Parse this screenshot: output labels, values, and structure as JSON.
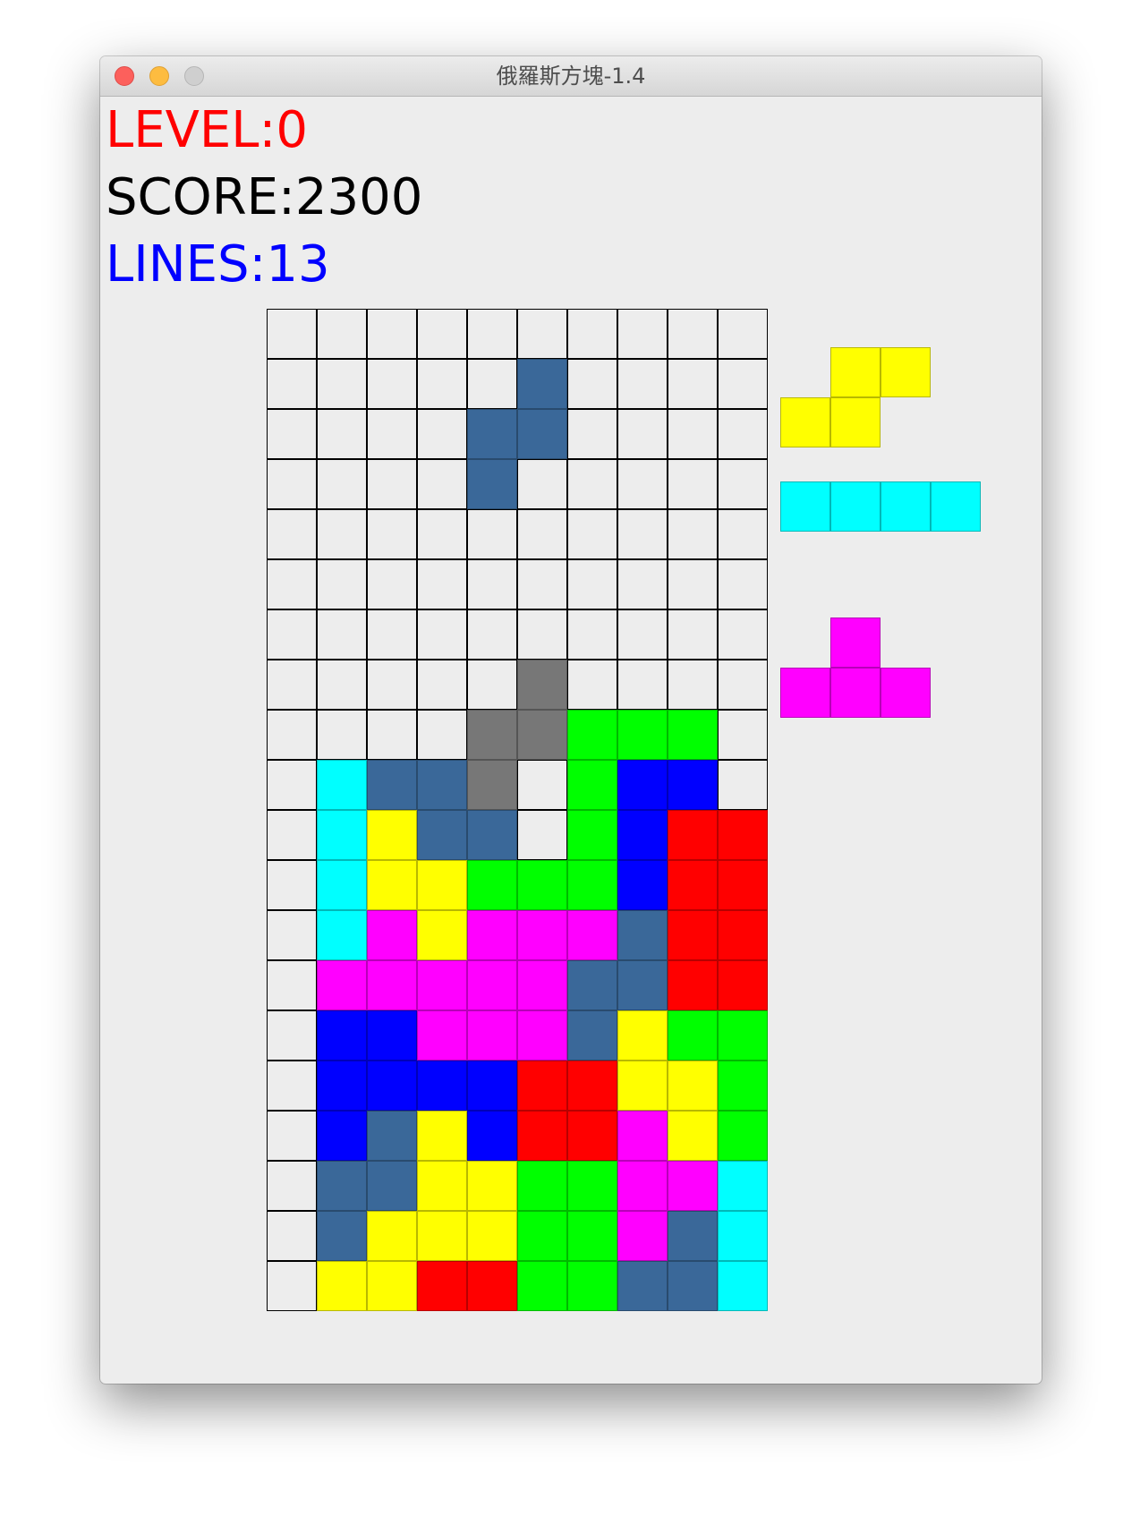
{
  "window": {
    "title": "俄羅斯方塊-1.4"
  },
  "stats": {
    "level": "LEVEL:0",
    "score": "SCORE:2300",
    "lines": "LINES:13",
    "level_color": "#ff0000",
    "score_color": "#000000",
    "lines_color": "#0000ff"
  },
  "palette": {
    "C": "#00ffff",
    "B": "#3a6899",
    "b": "#0000ff",
    "Y": "#ffff00",
    "G": "#00ff00",
    "R": "#ff0000",
    "M": "#ff00ff",
    "D": "#777777"
  },
  "board": {
    "columns": 10,
    "rows": 20,
    "cells": [
      "..........",
      ".....B....",
      "....BB....",
      "....B.....",
      "..........",
      "..........",
      "..........",
      ".....D....",
      "....DDGGG.",
      ".CBBD.Gbb.",
      ".CYBB.GbRR",
      ".CYYGGGbRR",
      ".CMYMMMBRR",
      ".MMMMMBBRR",
      ".bbMMMBYGG",
      ".bbbbRRYYG",
      ".bBYbRRMYG",
      ".BBYYGGMMC",
      ".BYYYGGMBC",
      ".YYRRGGBBC"
    ]
  },
  "next_pieces": [
    {
      "name": "S",
      "rows": [
        ".YY",
        "YY."
      ]
    },
    {
      "name": "I",
      "rows": [
        "CCCC"
      ]
    },
    {
      "name": "T",
      "rows": [
        ".M.",
        "MMM"
      ]
    }
  ]
}
